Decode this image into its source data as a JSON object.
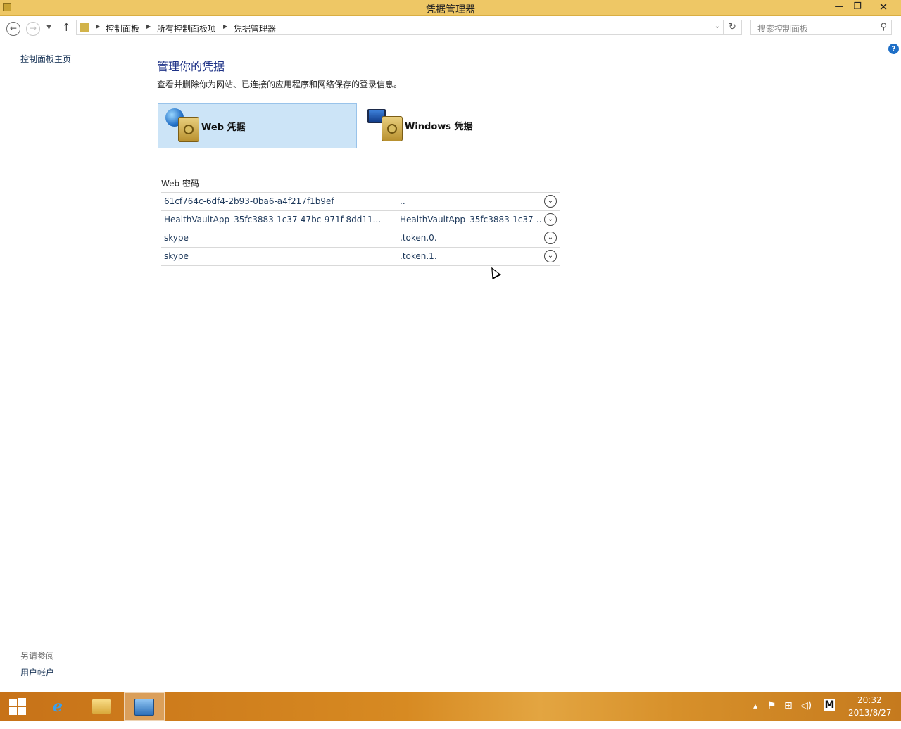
{
  "window": {
    "title": "凭据管理器",
    "minimize_glyph": "—",
    "maximize_glyph": "❐",
    "close_glyph": "✕"
  },
  "nav": {
    "back_glyph": "←",
    "forward_glyph": "→",
    "recent_glyph": "▼",
    "up_glyph": "↑",
    "breadcrumbs": [
      "控制面板",
      "所有控制面板项",
      "凭据管理器"
    ],
    "separator_glyph": "▶",
    "dropdown_glyph": "⌄",
    "refresh_glyph": "↻",
    "search_placeholder": "搜索控制面板",
    "search_glyph": "⚲"
  },
  "help_glyph": "?",
  "left_pane": {
    "home_link": "控制面板主页",
    "see_also_heading": "另请参阅",
    "see_also_links": [
      "用户帐户"
    ]
  },
  "main": {
    "heading": "管理你的凭据",
    "description": "查看并删除你为网站、已连接的应用程序和网络保存的登录信息。",
    "tiles": [
      {
        "label": "Web 凭据",
        "selected": true,
        "icon": "globe-vault-icon"
      },
      {
        "label": "Windows 凭据",
        "selected": false,
        "icon": "monitor-vault-icon"
      }
    ],
    "section_title": "Web 密码",
    "credentials": [
      {
        "resource": "61cf764c-6df4-2b93-0ba6-a4f217f1b9ef",
        "user": ".."
      },
      {
        "resource": "HealthVaultApp_35fc3883-1c37-47bc-971f-8dd11...",
        "user": "HealthVaultApp_35fc3883-1c37-..."
      },
      {
        "resource": "skype",
        "user": ".token.0."
      },
      {
        "resource": "skype",
        "user": ".token.1."
      }
    ],
    "expand_glyph": "⌄"
  },
  "taskbar": {
    "pinned": [
      "start-button",
      "internet-explorer",
      "file-explorer",
      "control-panel"
    ],
    "ie_glyph": "e",
    "tray": {
      "chevron_glyph": "▴",
      "flag_glyph": "⚑",
      "network_glyph": "⊞",
      "volume_glyph": "◁)",
      "ime_label": "M"
    },
    "time": "20:32",
    "date": "2013/8/27"
  },
  "colors": {
    "titlebar": "#eec765",
    "link": "#1e395b",
    "heading": "#1e3287",
    "selected_tile": "#cce4f7",
    "taskbar": "#d78a22"
  }
}
